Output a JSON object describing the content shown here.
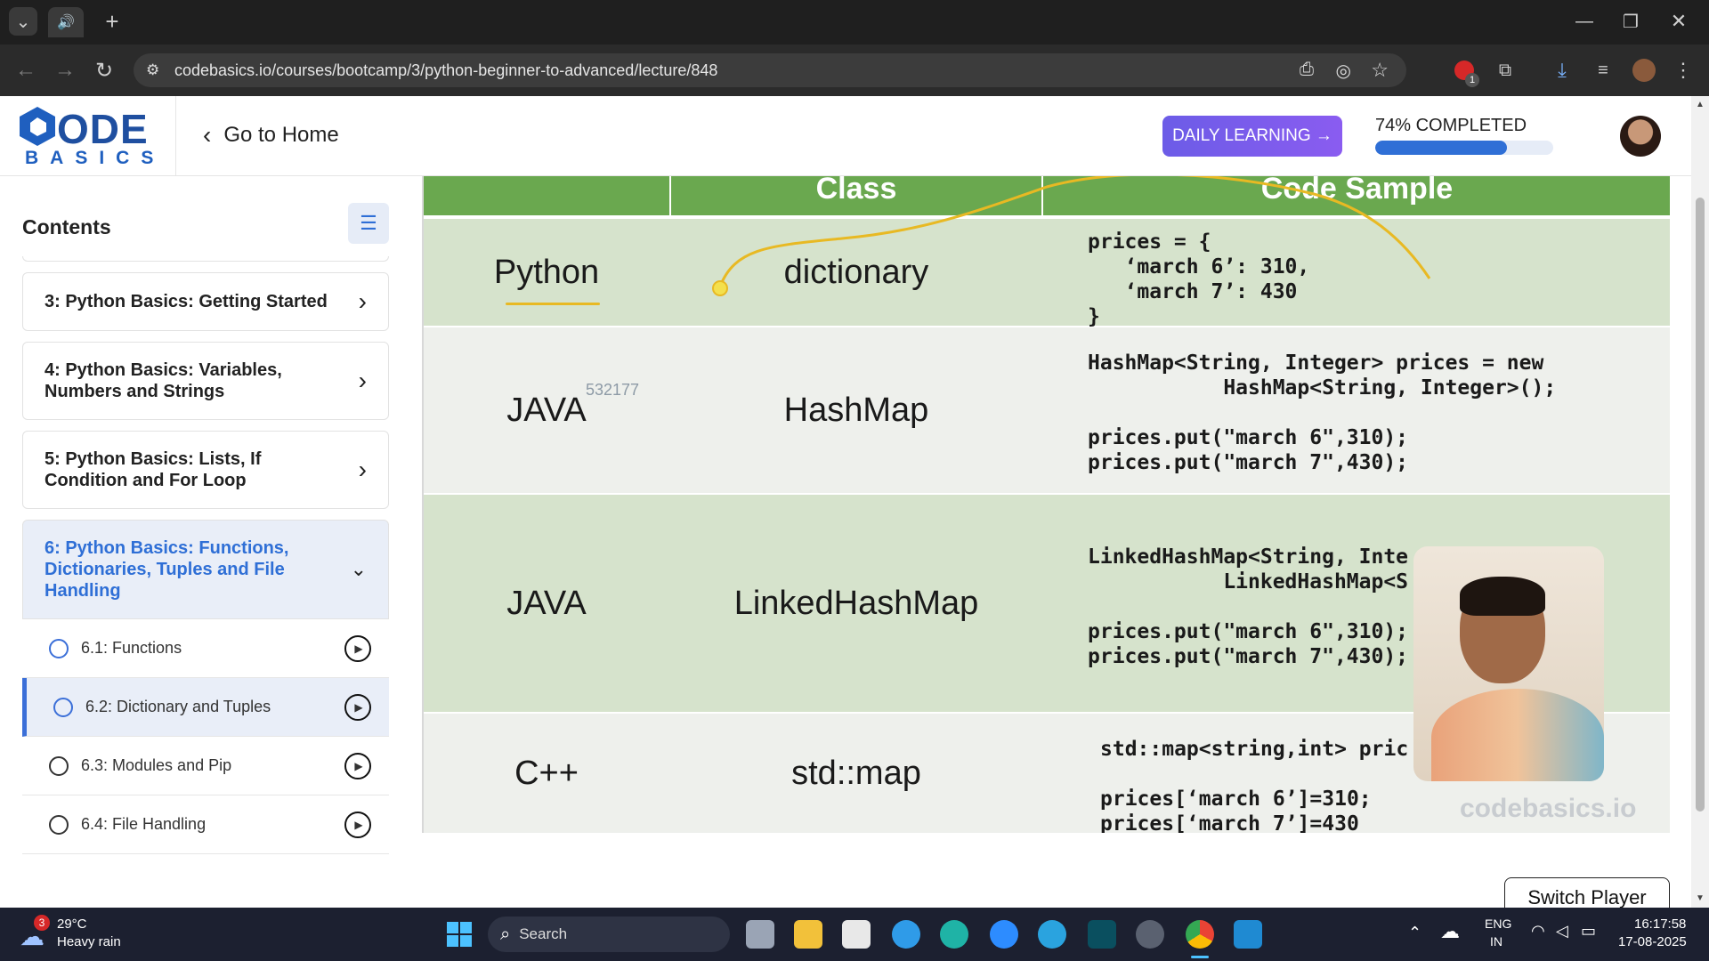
{
  "browser": {
    "url": "codebasics.io/courses/bootcamp/3/python-beginner-to-advanced/lecture/848",
    "extension_badge": "1"
  },
  "header": {
    "logo_top": "ODE",
    "logo_bottom": "BASICS",
    "go_home": "Go to Home",
    "daily_learning": "DAILY LEARNING →",
    "progress_text": "74% COMPLETED",
    "progress_value": 0.74
  },
  "sidebar": {
    "title": "Contents",
    "sections": [
      {
        "label": "3: Python Basics: Getting Started"
      },
      {
        "label": "4: Python Basics: Variables, Numbers and Strings"
      },
      {
        "label": "5: Python Basics: Lists, If Condition and For Loop"
      },
      {
        "label": "6: Python Basics: Functions, Dictionaries, Tuples and File Handling"
      }
    ],
    "lectures": [
      {
        "label": "6.1: Functions",
        "status": "completed"
      },
      {
        "label": "6.2: Dictionary and Tuples",
        "status": "completed"
      },
      {
        "label": "6.3: Modules and Pip",
        "status": "not-started"
      },
      {
        "label": "6.4: File Handling",
        "status": "not-started"
      }
    ]
  },
  "video": {
    "headers": [
      "Class",
      "Code Sample"
    ],
    "watermark_id": "532177",
    "watermark": "codebasics.io",
    "rows": [
      {
        "lang": "Python",
        "cls": "dictionary",
        "code": "prices = {\n   ‘march 6’: 310,\n   ‘march 7’: 430\n}"
      },
      {
        "lang": "JAVA",
        "cls": "HashMap",
        "code": "HashMap<String, Integer> prices = new\n           HashMap<String, Integer>();\n\nprices.put(\"march 6\",310);\nprices.put(\"march 7\",430);"
      },
      {
        "lang": "JAVA",
        "cls": "LinkedHashMap",
        "code": "LinkedHashMap<String, Inte           new\n           LinkedHashMap<S           ();\n\nprices.put(\"march 6\",310);\nprices.put(\"march 7\",430);"
      },
      {
        "lang": "C++",
        "cls": "std::map",
        "code": "std::map<string,int> pric\n\nprices[‘march 6’]=310;\nprices[‘march 7’]=430"
      }
    ],
    "switch_player": "Switch Player"
  },
  "taskbar": {
    "weather_temp": "29°C",
    "weather_desc": "Heavy rain",
    "weather_badge": "3",
    "search": "Search",
    "lang_top": "ENG",
    "lang_bottom": "IN",
    "time": "16:17:58",
    "date": "17-08-2025"
  },
  "colors": {
    "green_header": "#6aa84f",
    "row_green": "#d6e3cc",
    "row_light": "#eef0ec",
    "accent_purple": "#6c5ce7",
    "progress_blue": "#2f6fd6",
    "active_blue": "#3b6fd8"
  }
}
